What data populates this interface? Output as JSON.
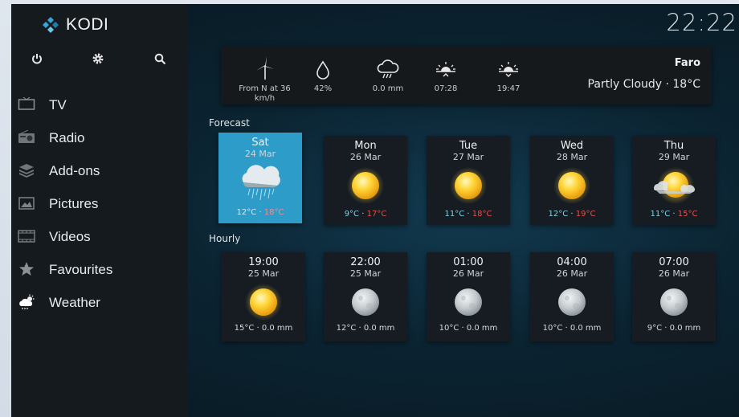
{
  "app": {
    "name": "KODI",
    "clock": "22:22"
  },
  "sidebar": {
    "top_icons": [
      "power-icon",
      "gear-icon",
      "search-icon"
    ],
    "items": [
      {
        "label": "TV",
        "icon": "tv-icon"
      },
      {
        "label": "Radio",
        "icon": "radio-icon"
      },
      {
        "label": "Add-ons",
        "icon": "addons-icon"
      },
      {
        "label": "Pictures",
        "icon": "pictures-icon"
      },
      {
        "label": "Videos",
        "icon": "videos-icon"
      },
      {
        "label": "Favourites",
        "icon": "star-icon"
      },
      {
        "label": "Weather",
        "icon": "weather-icon"
      }
    ]
  },
  "current": {
    "wind": "From N at 36 km/h",
    "humidity": "42%",
    "precipitation": "0.0 mm",
    "sunrise": "07:28",
    "sunset": "19:47",
    "location": "Faro",
    "condition": "Partly Cloudy · 18°C"
  },
  "forecast": {
    "title": "Forecast",
    "days": [
      {
        "day": "Sat",
        "date": "24 Mar",
        "low": "12°C",
        "high": "18°C",
        "icon": "rain-cloud-icon",
        "selected": true
      },
      {
        "day": "Mon",
        "date": "26 Mar",
        "low": "9°C",
        "high": "17°C",
        "icon": "sun-icon"
      },
      {
        "day": "Tue",
        "date": "27 Mar",
        "low": "11°C",
        "high": "18°C",
        "icon": "sun-icon"
      },
      {
        "day": "Wed",
        "date": "28 Mar",
        "low": "12°C",
        "high": "19°C",
        "icon": "sun-icon"
      },
      {
        "day": "Thu",
        "date": "29 Mar",
        "low": "11°C",
        "high": "15°C",
        "icon": "partly-sunny-icon"
      }
    ]
  },
  "hourly": {
    "title": "Hourly",
    "hours": [
      {
        "time": "19:00",
        "date": "25 Mar",
        "temp": "15°C · 0.0 mm",
        "icon": "sun-icon"
      },
      {
        "time": "22:00",
        "date": "25 Mar",
        "temp": "12°C · 0.0 mm",
        "icon": "moon-icon"
      },
      {
        "time": "01:00",
        "date": "26 Mar",
        "temp": "10°C · 0.0 mm",
        "icon": "moon-icon"
      },
      {
        "time": "04:00",
        "date": "26 Mar",
        "temp": "10°C · 0.0 mm",
        "icon": "moon-icon"
      },
      {
        "time": "07:00",
        "date": "26 Mar",
        "temp": "9°C · 0.0 mm",
        "icon": "moon-icon"
      }
    ]
  },
  "colors": {
    "accent": "#2e9cc9",
    "low_temp": "#7fd0e6",
    "high_temp": "#e4504b"
  }
}
